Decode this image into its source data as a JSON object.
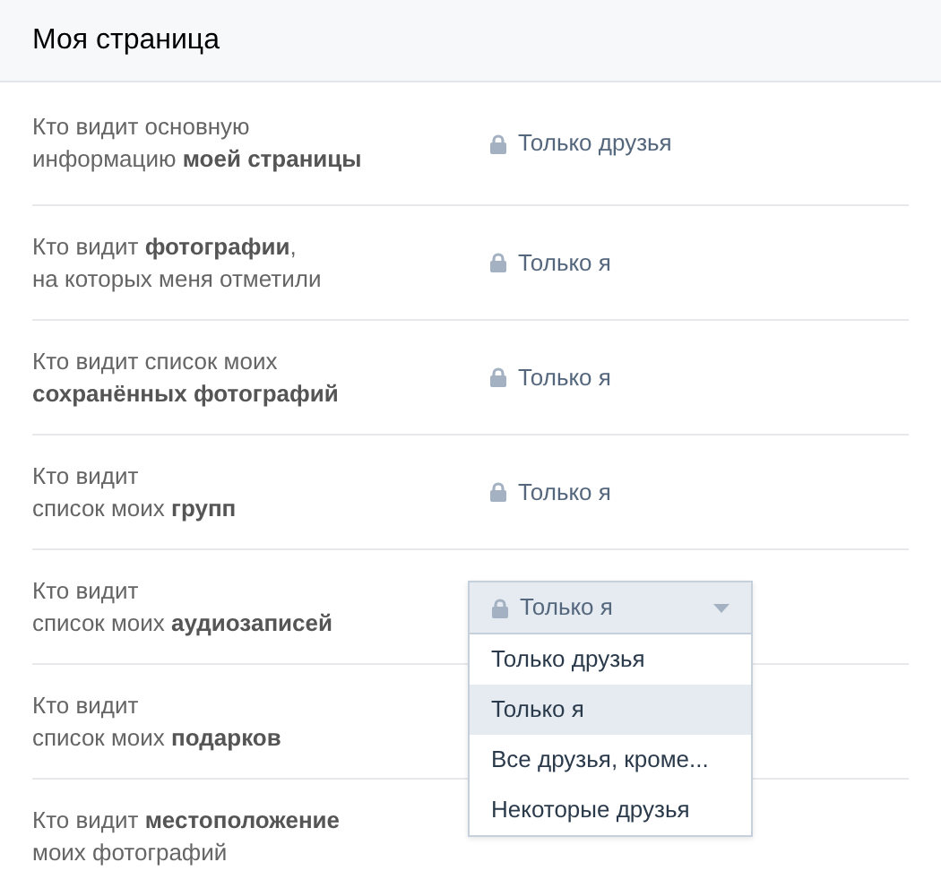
{
  "header": {
    "title": "Моя страница"
  },
  "rows": [
    {
      "label": [
        "Кто видит основную",
        "информацию **моей страницы**"
      ],
      "value": "Только друзья"
    },
    {
      "label": [
        "Кто видит **фотографии**,",
        "на которых меня отметили"
      ],
      "value": "Только я"
    },
    {
      "label": [
        "Кто видит список моих",
        "**сохранённых фотографий**"
      ],
      "value": "Только я"
    },
    {
      "label": [
        "Кто видит",
        "список моих **групп**"
      ],
      "value": "Только я"
    },
    {
      "label": [
        "Кто видит",
        "список моих **аудиозаписей**"
      ],
      "value": "Только я",
      "options": [
        {
          "label": "Только друзья",
          "selected": false
        },
        {
          "label": "Только я",
          "selected": true
        },
        {
          "label": "Все друзья, кроме...",
          "selected": false
        },
        {
          "label": "Некоторые друзья",
          "selected": false
        }
      ]
    },
    {
      "label": [
        "Кто видит",
        "список моих **подарков**"
      ]
    },
    {
      "label": [
        "Кто видит **местоположение**",
        "моих фотографий"
      ]
    }
  ]
}
